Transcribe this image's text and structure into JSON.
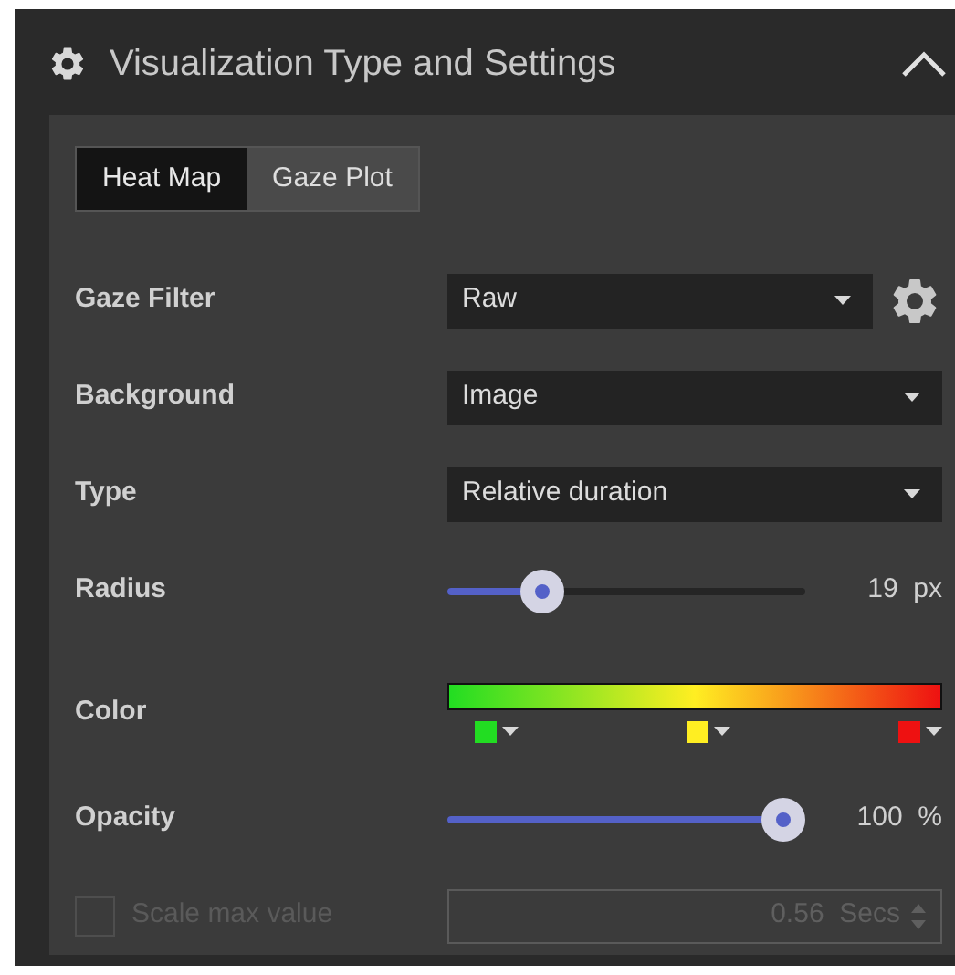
{
  "panel": {
    "title": "Visualization Type and Settings",
    "expanded": true
  },
  "tabs": [
    {
      "label": "Heat Map",
      "selected": true
    },
    {
      "label": "Gaze Plot",
      "selected": false
    }
  ],
  "rows": [
    {
      "kind": "dropdown_settings",
      "label": "Gaze Filter",
      "value": "Raw"
    },
    {
      "kind": "dropdown",
      "label": "Background",
      "value": "Image"
    },
    {
      "kind": "dropdown",
      "label": "Type",
      "value": "Relative duration"
    },
    {
      "kind": "slider",
      "label": "Radius",
      "level": 0.22,
      "reading": "19",
      "unit": "px"
    },
    {
      "kind": "colors",
      "label": "Color",
      "stops": [
        {
          "color": "#22dd22"
        },
        {
          "color": "#ffee22"
        },
        {
          "color": "#ee1111"
        }
      ]
    },
    {
      "kind": "slider",
      "label": "Opacity",
      "level": 1,
      "reading": "100",
      "unit": "%"
    },
    {
      "kind": "scale",
      "label": "Scale max value",
      "checked": false,
      "disabled": true,
      "value": "0.56",
      "unit": "Secs"
    }
  ]
}
